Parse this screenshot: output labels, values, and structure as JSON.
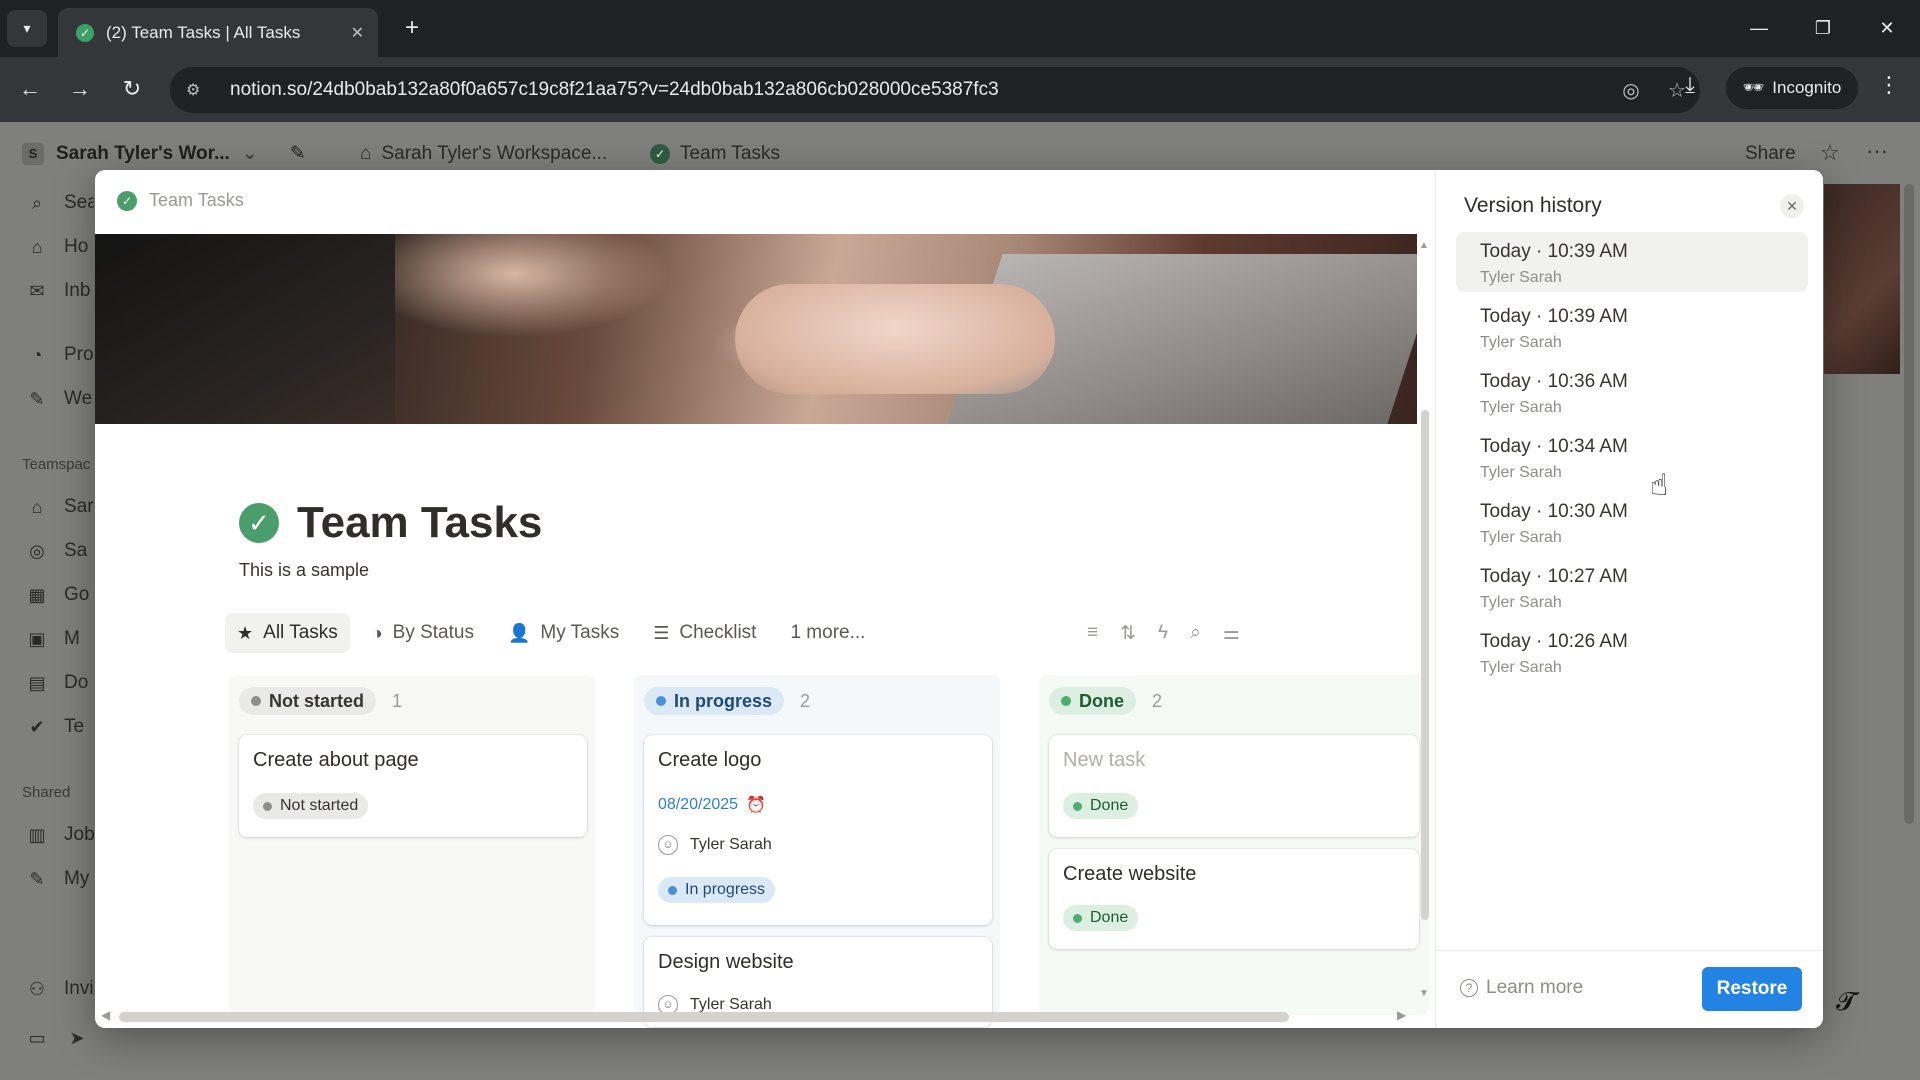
{
  "browser": {
    "tab_title": "(2) Team Tasks | All Tasks",
    "url": "notion.so/24db0bab132a80f0a657c19c8f21aa75?v=24db0bab132a806cb028000ce5387fc3",
    "incognito_label": "Incognito"
  },
  "background": {
    "workspace_initial": "S",
    "workspace_name": "Sarah Tyler's Wor...",
    "breadcrumbs": [
      "Sarah Tyler's Workspace...",
      "Team Tasks"
    ],
    "share_label": "Share",
    "sidebar": [
      "Sea",
      "Ho",
      "Inb",
      "Pro",
      "We",
      "Sar",
      "Sa",
      "Go",
      "M",
      "Do",
      "Te",
      "Job",
      "My",
      "Invi"
    ],
    "section_teamspaces": "Teamspac",
    "section_shared": "Shared"
  },
  "page": {
    "header_label": "Team Tasks",
    "title": "Team Tasks",
    "description": "This is a sample",
    "views": [
      "All Tasks",
      "By Status",
      "My Tasks",
      "Checklist",
      "1 more..."
    ]
  },
  "board": {
    "columns": [
      {
        "status": "Not started",
        "count": "1",
        "cards": [
          {
            "title": "Create about page",
            "status": "Not started"
          }
        ]
      },
      {
        "status": "In progress",
        "count": "2",
        "cards": [
          {
            "title": "Create logo",
            "date": "08/20/2025",
            "assignee": "Tyler Sarah",
            "status": "In progress"
          },
          {
            "title": "Design website",
            "assignee": "Tyler Sarah"
          }
        ]
      },
      {
        "status": "Done",
        "count": "2",
        "cards": [
          {
            "title": "New task",
            "status": "Done"
          },
          {
            "title": "Create website",
            "status": "Done"
          }
        ]
      }
    ]
  },
  "version_history": {
    "title": "Version history",
    "items": [
      {
        "time": "Today · 10:39 AM",
        "author": "Tyler Sarah"
      },
      {
        "time": "Today · 10:39 AM",
        "author": "Tyler Sarah"
      },
      {
        "time": "Today · 10:36 AM",
        "author": "Tyler Sarah"
      },
      {
        "time": "Today · 10:34 AM",
        "author": "Tyler Sarah"
      },
      {
        "time": "Today · 10:30 AM",
        "author": "Tyler Sarah"
      },
      {
        "time": "Today · 10:27 AM",
        "author": "Tyler Sarah"
      },
      {
        "time": "Today · 10:26 AM",
        "author": "Tyler Sarah"
      }
    ],
    "learn_more": "Learn more",
    "restore": "Restore"
  },
  "colors": {
    "accent_blue": "#2383e2",
    "status_done": "#4caf6e",
    "status_in_progress": "#4a90d9",
    "status_not_started": "#8f8e8a"
  }
}
